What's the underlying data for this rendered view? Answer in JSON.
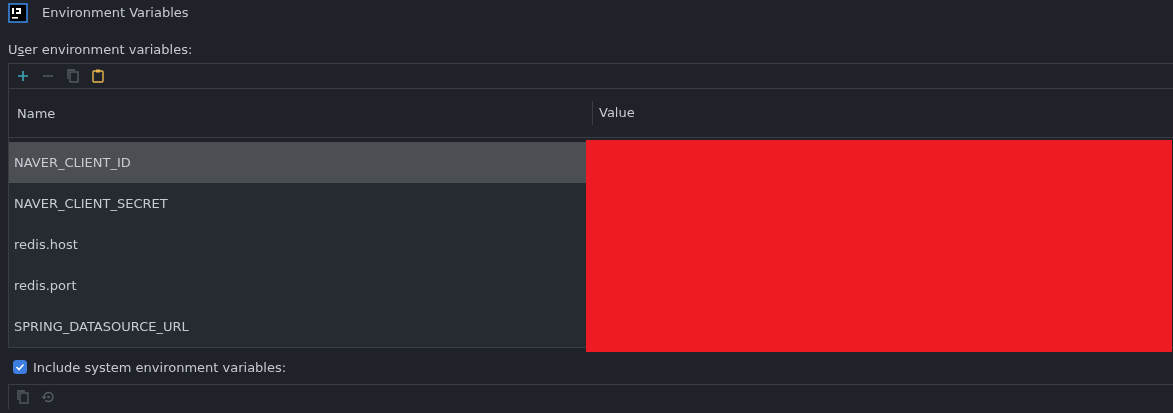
{
  "window": {
    "title": "Environment Variables"
  },
  "user_section": {
    "label": "User environment variables:"
  },
  "table": {
    "columns": [
      "Name",
      "Value"
    ],
    "rows": [
      {
        "name": "NAVER_CLIENT_ID",
        "selected": true
      },
      {
        "name": "NAVER_CLIENT_SECRET",
        "selected": false
      },
      {
        "name": "redis.host",
        "selected": false
      },
      {
        "name": "redis.port",
        "selected": false
      },
      {
        "name": "SPRING_DATASOURCE_URL",
        "selected": false
      }
    ]
  },
  "include_system": {
    "label": "Include system environment variables:",
    "checked": true
  }
}
